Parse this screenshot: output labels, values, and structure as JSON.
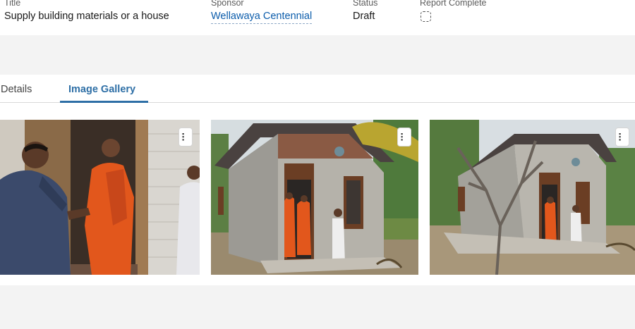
{
  "header": {
    "title_label": "Title",
    "title_value": "Supply building materials or a house",
    "sponsor_label": "Sponsor",
    "sponsor_value": "Wellawaya Centennial",
    "status_label": "Status",
    "status_value": "Draft",
    "report_label": "Report Complete"
  },
  "tabs": [
    {
      "label": "Details"
    },
    {
      "label": "Image Gallery"
    }
  ],
  "active_tab": "Image Gallery",
  "gallery": {
    "menu_glyph": "..."
  },
  "colors": {
    "accent": "#2e6fa6",
    "link": "#0b5cab",
    "robe": "#e2571c"
  }
}
